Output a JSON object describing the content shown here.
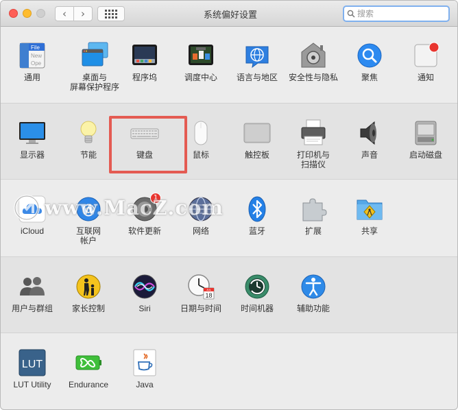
{
  "window": {
    "title": "系统偏好设置",
    "search_placeholder": "搜索"
  },
  "colors": {
    "highlight": "#e45b52",
    "badge": "#e8352f",
    "search_focus": "#7fb0ee"
  },
  "watermark": {
    "text": "www.MacZ.com"
  },
  "rows": [
    {
      "items": [
        {
          "label": "通用",
          "icon": "general-icon"
        },
        {
          "label": "桌面与\n屏幕保护程序",
          "icon": "desktop-screensaver-icon"
        },
        {
          "label": "程序坞",
          "icon": "dock-icon"
        },
        {
          "label": "调度中心",
          "icon": "mission-control-icon"
        },
        {
          "label": "语言与地区",
          "icon": "language-region-icon"
        },
        {
          "label": "安全性与隐私",
          "icon": "security-privacy-icon"
        },
        {
          "label": "聚焦",
          "icon": "spotlight-icon"
        },
        {
          "label": "通知",
          "icon": "notifications-icon"
        }
      ]
    },
    {
      "items": [
        {
          "label": "显示器",
          "icon": "displays-icon"
        },
        {
          "label": "节能",
          "icon": "energy-saver-icon"
        },
        {
          "label": "键盘",
          "icon": "keyboard-icon"
        },
        {
          "label": "鼠标",
          "icon": "mouse-icon"
        },
        {
          "label": "触控板",
          "icon": "trackpad-icon"
        },
        {
          "label": "打印机与\n扫描仪",
          "icon": "printers-scanners-icon"
        },
        {
          "label": "声音",
          "icon": "sound-icon"
        },
        {
          "label": "启动磁盘",
          "icon": "startup-disk-icon"
        }
      ]
    },
    {
      "items": [
        {
          "label": "iCloud",
          "icon": "icloud-icon"
        },
        {
          "label": "互联网\n帐户",
          "icon": "internet-accounts-icon"
        },
        {
          "label": "软件更新",
          "icon": "software-update-icon",
          "badge": "1"
        },
        {
          "label": "网络",
          "icon": "network-icon"
        },
        {
          "label": "蓝牙",
          "icon": "bluetooth-icon"
        },
        {
          "label": "扩展",
          "icon": "extensions-icon"
        },
        {
          "label": "共享",
          "icon": "sharing-icon"
        }
      ]
    },
    {
      "items": [
        {
          "label": "用户与群组",
          "icon": "users-groups-icon"
        },
        {
          "label": "家长控制",
          "icon": "parental-controls-icon"
        },
        {
          "label": "Siri",
          "icon": "siri-icon"
        },
        {
          "label": "日期与时间",
          "icon": "date-time-icon",
          "cal_month": "JUL",
          "cal_day": "18"
        },
        {
          "label": "时间机器",
          "icon": "time-machine-icon"
        },
        {
          "label": "辅助功能",
          "icon": "accessibility-icon"
        }
      ]
    },
    {
      "items": [
        {
          "label": "LUT Utility",
          "icon": "lut-utility-icon",
          "icon_text": "LUT"
        },
        {
          "label": "Endurance",
          "icon": "endurance-icon"
        },
        {
          "label": "Java",
          "icon": "java-icon"
        }
      ]
    }
  ],
  "general_icon_text": [
    "File",
    "New",
    "Ope"
  ]
}
